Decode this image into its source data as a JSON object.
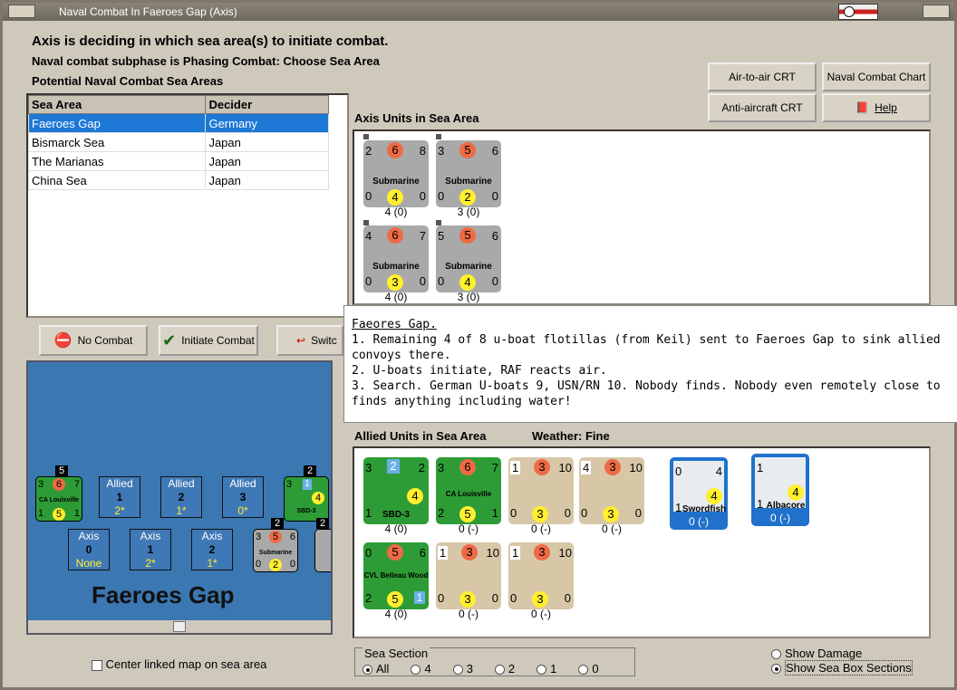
{
  "window": {
    "title": "Naval Combat In Faeroes Gap (Axis)"
  },
  "header": {
    "main": "Axis is deciding in which sea area(s) to initiate combat.",
    "subphase": "Naval combat subphase is Phasing Combat: Choose Sea Area",
    "potential": "Potential Naval Combat Sea Areas"
  },
  "crt_buttons": {
    "air_to_air": "Air-to-air CRT",
    "naval_chart": "Naval Combat Chart",
    "anti_aircraft": "Anti-aircraft CRT",
    "help": "Help"
  },
  "sea_table": {
    "headers": [
      "Sea Area",
      "Decider"
    ],
    "rows": [
      {
        "area": "Faeroes Gap",
        "decider": "Germany"
      },
      {
        "area": "Bismarck Sea",
        "decider": "Japan"
      },
      {
        "area": "The Marianas",
        "decider": "Japan"
      },
      {
        "area": "China Sea",
        "decider": "Japan"
      }
    ]
  },
  "axis_units_label": "Axis Units in Sea Area",
  "axis_units": [
    {
      "tl": "2",
      "orange": "6",
      "tr": "8",
      "name": "Submarine",
      "bl": "0",
      "yellow": "4",
      "br": "0",
      "caption": "4 (0)"
    },
    {
      "tl": "3",
      "orange": "5",
      "tr": "6",
      "name": "Submarine",
      "bl": "0",
      "yellow": "2",
      "br": "0",
      "caption": "3 (0)"
    },
    {
      "tl": "4",
      "orange": "6",
      "tr": "7",
      "name": "Submarine",
      "bl": "0",
      "yellow": "3",
      "br": "0",
      "caption": "4 (0)"
    },
    {
      "tl": "5",
      "orange": "5",
      "tr": "6",
      "name": "Submarine",
      "bl": "0",
      "yellow": "4",
      "br": "0",
      "caption": "3 (0)"
    }
  ],
  "action_buttons": {
    "no_combat": "No Combat",
    "initiate": "Initiate Combat",
    "switch": "Switc"
  },
  "tooltip": {
    "title": "Faeores Gap.",
    "lines": [
      "1. Remaining 4 of 8 u-boat flotillas (from Keil) sent to Faeroes Gap to sink allied convoys there.",
      "2. U-boats initiate, RAF reacts air.",
      "3. Search. German U-boats 9, USN/RN 10.  Nobody finds.  Nobody even remotely close to finds anything including water!"
    ]
  },
  "allied_label": "Allied Units in Sea Area",
  "weather": "Weather:  Fine",
  "allied_units_row1": [
    {
      "tl": "3",
      "tr": "2",
      "name": "SBD-3",
      "bl": "1",
      "yellow": "4",
      "caption": "4 (0)"
    },
    {
      "tl": "3",
      "orange": "6",
      "tr": "7",
      "name": "CA Louisville",
      "bl": "2",
      "yellow": "5",
      "br": "1",
      "caption": "0 (-)"
    },
    {
      "tl": "1",
      "orange": "3",
      "tr": "10",
      "bl": "0",
      "yellow": "3",
      "br": "0",
      "caption": "0 (-)"
    },
    {
      "tl": "4",
      "orange": "3",
      "tr": "10",
      "bl": "0",
      "yellow": "3",
      "br": "0",
      "caption": "0 (-)"
    }
  ],
  "allied_air": [
    {
      "name": "Swordfish",
      "tl": "0",
      "tr": "4",
      "yellow": "4",
      "bl": "1",
      "caption": "0 (-)"
    },
    {
      "name": "Albacore",
      "tl": "1",
      "yellow": "4",
      "bl": "1",
      "caption": "0 (-)"
    }
  ],
  "allied_units_row2": [
    {
      "tl": "0",
      "orange": "5",
      "tr": "6",
      "name": "CVL Belleau Wood",
      "bl": "2",
      "yellow": "5",
      "br": "1",
      "caption": "4 (0)"
    },
    {
      "tl": "1",
      "orange": "3",
      "tr": "10",
      "bl": "0",
      "yellow": "3",
      "br": "0",
      "caption": "0 (-)"
    },
    {
      "tl": "1",
      "orange": "3",
      "tr": "10",
      "bl": "0",
      "yellow": "3",
      "br": "0",
      "caption": "0 (-)"
    }
  ],
  "map": {
    "title": "Faeroes Gap",
    "allied_boxes": [
      {
        "label": "Allied",
        "n": "1",
        "v": "2*"
      },
      {
        "label": "Allied",
        "n": "2",
        "v": "1*"
      },
      {
        "label": "Allied",
        "n": "3",
        "v": "0*"
      }
    ],
    "axis_boxes": [
      {
        "label": "Axis",
        "n": "0",
        "v": "None"
      },
      {
        "label": "Axis",
        "n": "1",
        "v": "2*"
      },
      {
        "label": "Axis",
        "n": "2",
        "v": "1*"
      }
    ],
    "stack_counts": [
      "5",
      "2",
      "2",
      "2"
    ],
    "ca_unit": {
      "tl": "3",
      "orange": "6",
      "tr": "7",
      "name": "CA Louisville",
      "bl": "1",
      "yellow": "5",
      "br": "1"
    },
    "sbd_unit": {
      "tl": "3",
      "tr": "1",
      "name": "SBD-3",
      "yellow": "4"
    },
    "sub_unit": {
      "tl": "3",
      "orange": "5",
      "tr": "6",
      "name": "Submarine",
      "bl": "0",
      "yellow": "2",
      "br": "0"
    }
  },
  "center_label": "Center linked map on sea area",
  "sea_section": {
    "label": "Sea Section",
    "options": [
      "All",
      "4",
      "3",
      "2",
      "1",
      "0"
    ],
    "selected": "All"
  },
  "options": {
    "show_damage": "Show Damage",
    "show_boxes": "Show Sea Box Sections"
  },
  "colors": {
    "selection": "#1d78d6",
    "map_blue": "#3b77b1",
    "orange": "#ee6a45",
    "yellow": "#ffef2e"
  }
}
